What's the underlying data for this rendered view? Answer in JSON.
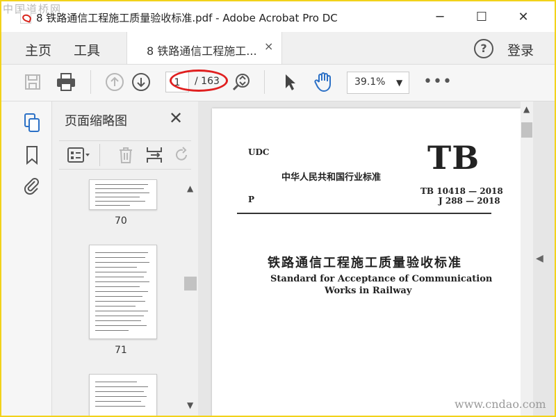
{
  "watermark": {
    "top": "中国道桥网",
    "bottom": "www.cndao.com"
  },
  "titlebar": {
    "title": "8 铁路通信工程施工质量验收标准.pdf - Adobe Acrobat Pro DC",
    "minimize": "─",
    "maximize": "☐",
    "close": "✕"
  },
  "tabs": {
    "home": "主页",
    "tools": "工具",
    "doc_tab": "8 铁路通信工程施工...",
    "doc_close": "×",
    "help": "?",
    "login": "登录"
  },
  "toolbar": {
    "page_current": "1",
    "page_total": "/ 163",
    "zoom": "39.1%",
    "zoom_caret": "▼",
    "more": "•••"
  },
  "thumbs": {
    "header": "页面缩略图",
    "close": "✕",
    "pages": [
      {
        "label": "70"
      },
      {
        "label": "71"
      }
    ]
  },
  "document": {
    "udc": "UDC",
    "cn_std": "中华人民共和国行业标准",
    "tb_big": "TB",
    "code1": "TB 10418 — 2018",
    "code2": "J 288 — 2018",
    "p": "P",
    "title_cn": "铁路通信工程施工质量验收标准",
    "title_en1": "Standard for Acceptance of Communication",
    "title_en2": "Works in Railway"
  },
  "colors": {
    "frame": "#f2d21a",
    "annotation": "#e02020",
    "accent": "#2b70c6"
  },
  "icons": [
    "save-icon",
    "print-icon",
    "page-up-icon",
    "page-down-icon",
    "zoom-fit-icon",
    "select-arrow-icon",
    "hand-tool-icon",
    "thumbnails-icon",
    "bookmark-icon",
    "attachment-icon",
    "thumb-options-icon",
    "delete-icon",
    "insert-pages-icon",
    "rotate-icon"
  ]
}
